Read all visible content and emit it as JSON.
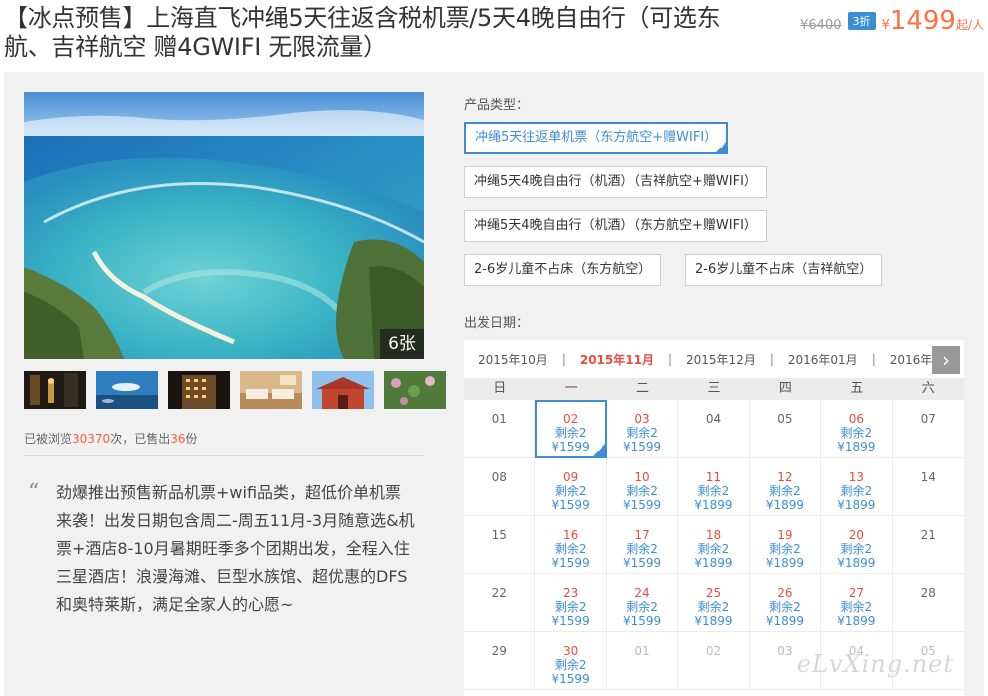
{
  "product": {
    "title": "【冰点预售】上海直飞冲绳5天往返含税机票/5天4晚自由行（可选东航、吉祥航空 赠4GWIFI 无限流量）",
    "old_price": "¥6400",
    "discount": "3折",
    "currency": "¥",
    "price": "1499",
    "price_suffix": "起/人"
  },
  "gallery": {
    "count_label": "6张",
    "thumbs": [
      "night-street",
      "aquarium",
      "hotel-building",
      "hotel-room",
      "shuri-castle",
      "flowers"
    ]
  },
  "stats": {
    "prefix": "已被浏览",
    "views": "30370",
    "middle": "次，已售出",
    "sold": "36",
    "suffix": "份"
  },
  "description": {
    "quote": "“",
    "text": "劲爆推出预售新品机票+wifi品类，超低价单机票来袭！出发日期包含周二-周五11月-3月随意选&机票+酒店8-10月暑期旺季多个团期出发，全程入住三星酒店！浪漫海滩、巨型水族馆、超优惠的DFS和奥特莱斯，满足全家人的心愿~"
  },
  "product_type": {
    "label": "产品类型：",
    "options": [
      {
        "label": "冲绳5天往返单机票（东方航空+赠WIFI）",
        "selected": true
      },
      {
        "label": "冲绳5天4晚自由行（机酒）（吉祥航空+赠WIFI）",
        "selected": false
      },
      {
        "label": "冲绳5天4晚自由行（机酒）（东方航空+赠WIFI）",
        "selected": false
      },
      {
        "label": "2-6岁儿童不占床（东方航空）",
        "selected": false
      },
      {
        "label": "2-6岁儿童不占床（吉祥航空）",
        "selected": false
      }
    ]
  },
  "calendar": {
    "label": "出发日期：",
    "months": [
      "2015年10月",
      "2015年11月",
      "2015年12月",
      "2016年01月",
      "2016年"
    ],
    "active_month": 1,
    "separator": "|",
    "weekdays": [
      "日",
      "一",
      "二",
      "三",
      "四",
      "五",
      "六"
    ],
    "next_icon": "chevron-right-icon",
    "days": [
      {
        "d": "01"
      },
      {
        "d": "02",
        "r": "剩余2",
        "p": "¥1599",
        "sel": true
      },
      {
        "d": "03",
        "r": "剩余2",
        "p": "¥1599"
      },
      {
        "d": "04"
      },
      {
        "d": "05"
      },
      {
        "d": "06",
        "r": "剩余2",
        "p": "¥1899"
      },
      {
        "d": "07"
      },
      {
        "d": "08"
      },
      {
        "d": "09",
        "r": "剩余2",
        "p": "¥1599"
      },
      {
        "d": "10",
        "r": "剩余2",
        "p": "¥1599"
      },
      {
        "d": "11",
        "r": "剩余2",
        "p": "¥1899"
      },
      {
        "d": "12",
        "r": "剩余2",
        "p": "¥1899"
      },
      {
        "d": "13",
        "r": "剩余2",
        "p": "¥1899"
      },
      {
        "d": "14"
      },
      {
        "d": "15"
      },
      {
        "d": "16",
        "r": "剩余2",
        "p": "¥1599"
      },
      {
        "d": "17",
        "r": "剩余2",
        "p": "¥1599"
      },
      {
        "d": "18",
        "r": "剩余2",
        "p": "¥1899"
      },
      {
        "d": "19",
        "r": "剩余2",
        "p": "¥1899"
      },
      {
        "d": "20",
        "r": "剩余2",
        "p": "¥1899"
      },
      {
        "d": "21"
      },
      {
        "d": "22"
      },
      {
        "d": "23",
        "r": "剩余2",
        "p": "¥1599"
      },
      {
        "d": "24",
        "r": "剩余2",
        "p": "¥1599"
      },
      {
        "d": "25",
        "r": "剩余2",
        "p": "¥1899"
      },
      {
        "d": "26",
        "r": "剩余2",
        "p": "¥1899"
      },
      {
        "d": "27",
        "r": "剩余2",
        "p": "¥1899"
      },
      {
        "d": "28"
      },
      {
        "d": "29"
      },
      {
        "d": "30",
        "r": "剩余2",
        "p": "¥1599"
      },
      {
        "d": "01",
        "muted": true
      },
      {
        "d": "02",
        "muted": true
      },
      {
        "d": "03",
        "muted": true
      },
      {
        "d": "04",
        "muted": true
      },
      {
        "d": "05",
        "muted": true
      }
    ]
  },
  "watermark": "eLvXing.net",
  "colors": {
    "accent": "#3c8ed4",
    "price": "#ff7043",
    "date_available": "#e84c3d"
  }
}
